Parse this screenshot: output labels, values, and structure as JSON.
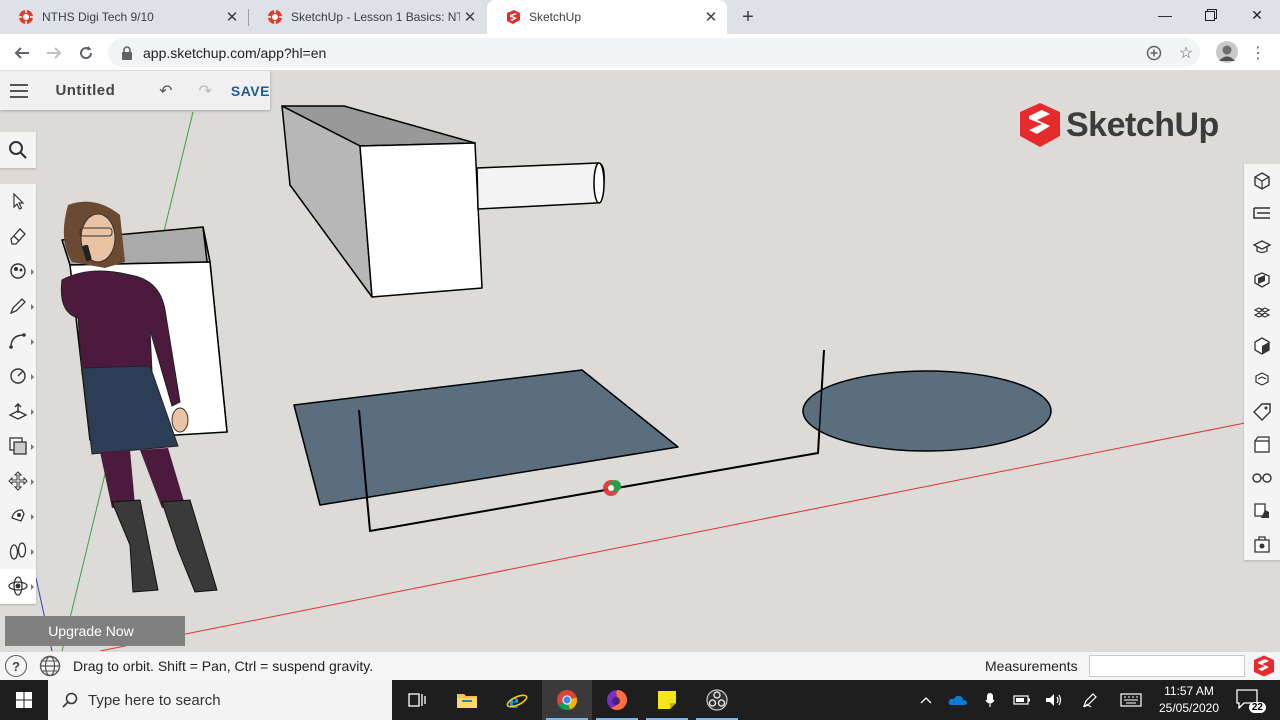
{
  "browser": {
    "tabs": [
      {
        "title": "NTHS Digi Tech 9/10",
        "active": false
      },
      {
        "title": "SketchUp - Lesson 1 Basics: NTHS",
        "active": false
      },
      {
        "title": "SketchUp",
        "active": true
      }
    ],
    "url": "app.sketchup.com/app?hl=en"
  },
  "sketchup": {
    "file_name": "Untitled",
    "save_label": "SAVE",
    "logo_text": "SketchUp",
    "upgrade_label": "Upgrade Now",
    "left_tools": [
      "select-icon",
      "eraser-icon",
      "paint-bucket-icon",
      "pencil-icon",
      "arc-icon",
      "circle-icon",
      "push-pull-icon",
      "offset-icon",
      "move-icon",
      "rotate-icon",
      "walk-icon",
      "orbit-icon"
    ],
    "active_tool": "orbit-icon",
    "right_panels": [
      "entity-info-icon",
      "outliner-icon",
      "instructor-icon",
      "components-icon",
      "materials-icon",
      "styles-icon",
      "scenes-icon",
      "tags-icon",
      "display-icon",
      "xray-icon",
      "shadows-icon",
      "solid-inspector-icon"
    ]
  },
  "statusbar": {
    "help_glyph": "?",
    "hint": "Drag to orbit. Shift = Pan, Ctrl = suspend gravity.",
    "measurements_label": "Measurements",
    "measurements_value": ""
  },
  "taskbar": {
    "search_placeholder": "Type here to search",
    "time": "11:57 AM",
    "date": "25/05/2020",
    "notification_count": "22"
  },
  "colors": {
    "viewport_bg": "#dcdbd8",
    "shape_fill": "#5b6e7e",
    "brand_red": "#e72b2d",
    "save_blue": "#1f5c99"
  }
}
